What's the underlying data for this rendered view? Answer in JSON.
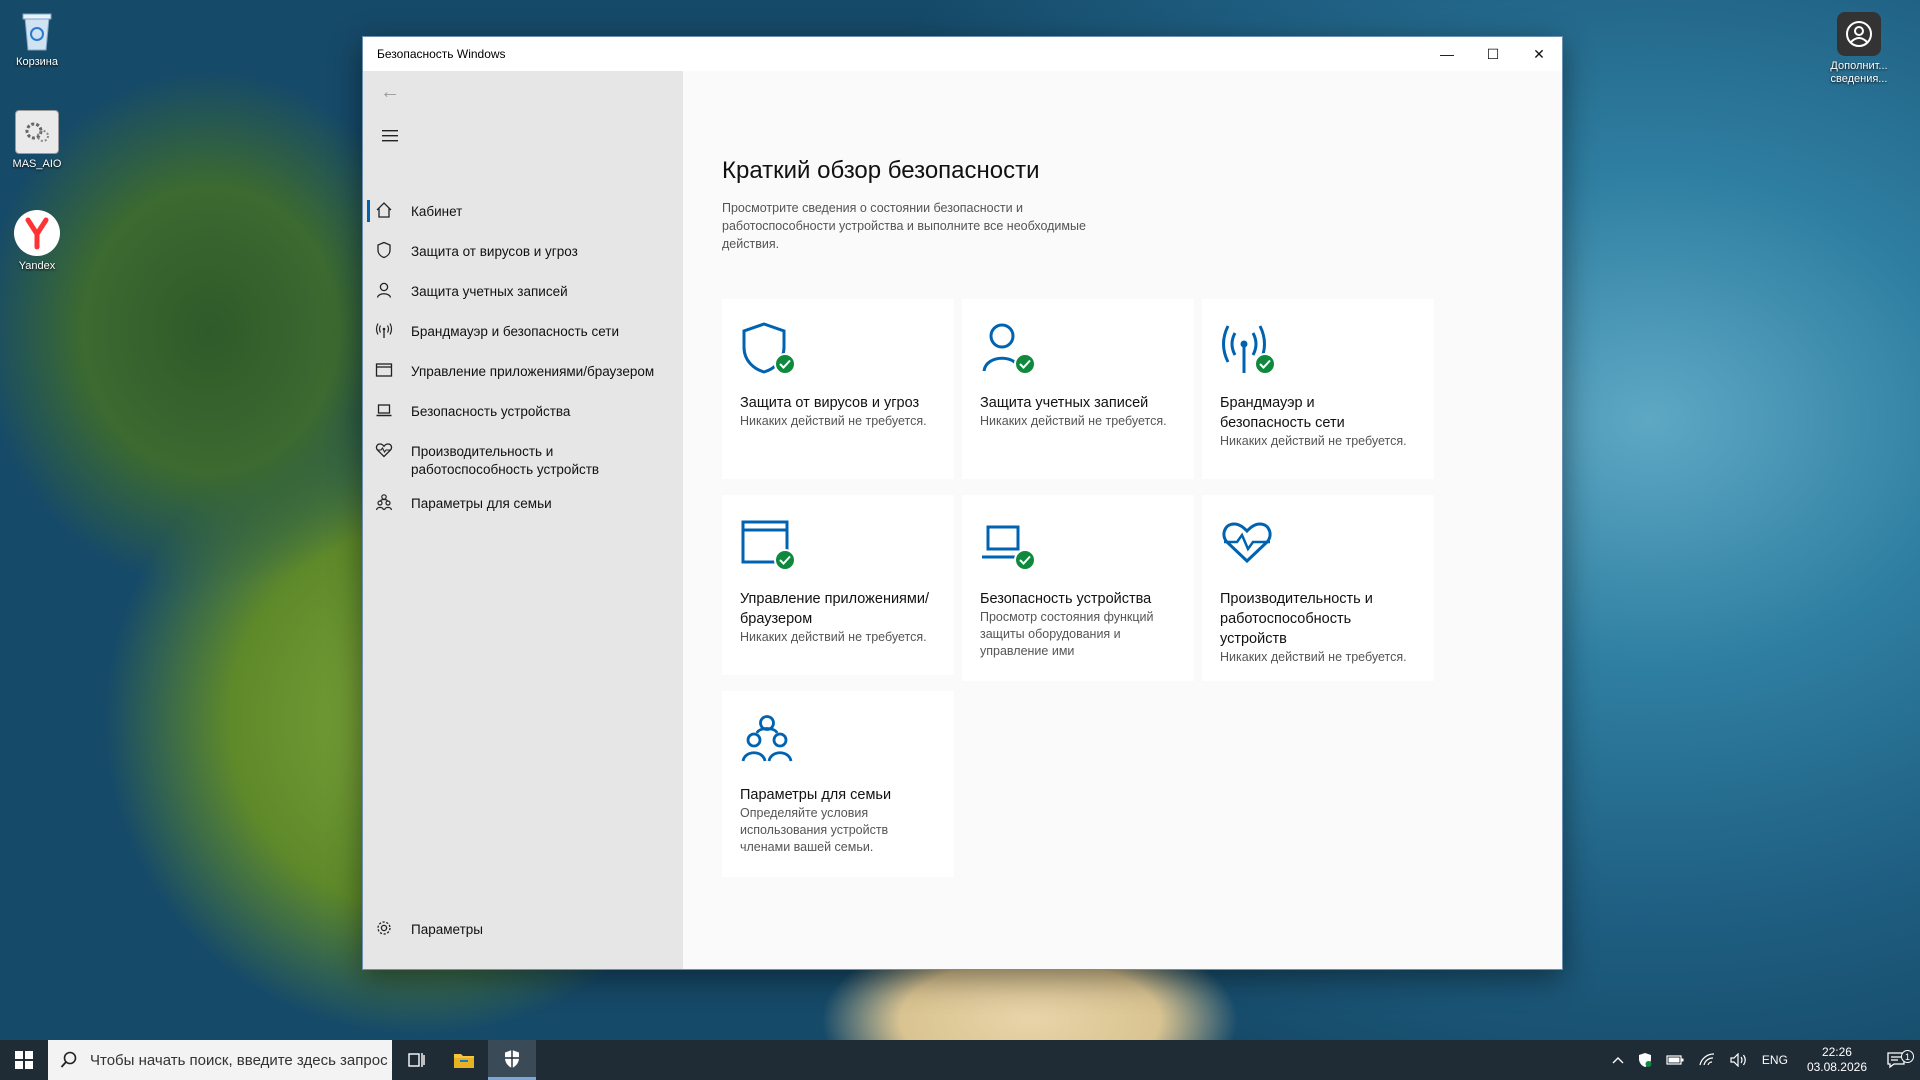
{
  "desktop": {
    "icons": [
      {
        "label": "Корзина"
      },
      {
        "label": "MAS_AIO"
      },
      {
        "label": "Yandex"
      }
    ],
    "top_right_label": "Дополнит... сведения..."
  },
  "window": {
    "title": "Безопасность Windows",
    "controls": {
      "minimize": "—",
      "maximize": "☐",
      "close": "✕"
    }
  },
  "sidebar": {
    "items": [
      {
        "label": "Кабинет",
        "icon": "home-icon"
      },
      {
        "label": "Защита от вирусов и угроз",
        "icon": "shield-icon"
      },
      {
        "label": "Защита учетных записей",
        "icon": "person-icon"
      },
      {
        "label": "Брандмауэр и безопасность сети",
        "icon": "antenna-icon"
      },
      {
        "label": "Управление приложениями/браузером",
        "icon": "browser-window-icon"
      },
      {
        "label": "Безопасность устройства",
        "icon": "laptop-icon"
      },
      {
        "label": "Производительность и работоспособность устройств",
        "icon": "heart-icon"
      },
      {
        "label": "Параметры для семьи",
        "icon": "family-icon"
      }
    ],
    "settings": "Параметры"
  },
  "main": {
    "title": "Краткий обзор безопасности",
    "description": "Просмотрите сведения о состоянии безопасности и работоспособности устройства и выполните все необходимые действия.",
    "tiles": [
      {
        "title": "Защита от вирусов и угроз",
        "subtitle": "Никаких действий не требуется."
      },
      {
        "title": "Защита учетных записей",
        "subtitle": "Никаких действий не требуется."
      },
      {
        "title": "Брандмауэр и безопасность сети",
        "subtitle": "Никаких действий не требуется."
      },
      {
        "title": "Управление приложениями/браузером",
        "subtitle": "Никаких действий не требуется."
      },
      {
        "title": "Безопасность устройства",
        "subtitle": "Просмотр состояния функций защиты оборудования и управление ими"
      },
      {
        "title": "Производительность и работоспособность устройств",
        "subtitle": "Никаких действий не требуется."
      },
      {
        "title": "Параметры для семьи",
        "subtitle": "Определяйте условия использования устройств членами вашей семьи."
      }
    ]
  },
  "taskbar": {
    "search_placeholder": "Чтобы начать поиск, введите здесь запрос",
    "language": "ENG",
    "time": "22:26",
    "date": "03.08.2026",
    "notification_count": "1"
  },
  "colors": {
    "accent": "#0063b1",
    "ok": "#10893e"
  }
}
